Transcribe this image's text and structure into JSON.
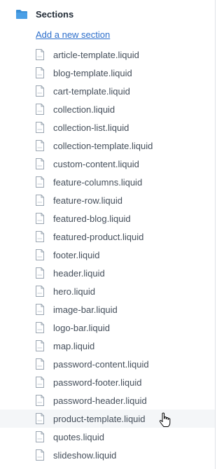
{
  "sidebar": {
    "section_title": "Sections",
    "add_link": "Add a new section",
    "files": [
      "article-template.liquid",
      "blog-template.liquid",
      "cart-template.liquid",
      "collection.liquid",
      "collection-list.liquid",
      "collection-template.liquid",
      "custom-content.liquid",
      "feature-columns.liquid",
      "feature-row.liquid",
      "featured-blog.liquid",
      "featured-product.liquid",
      "footer.liquid",
      "header.liquid",
      "hero.liquid",
      "image-bar.liquid",
      "logo-bar.liquid",
      "map.liquid",
      "password-content.liquid",
      "password-footer.liquid",
      "password-header.liquid",
      "product-template.liquid",
      "quotes.liquid",
      "slideshow.liquid"
    ],
    "hovered_file": "product-template.liquid"
  },
  "colors": {
    "folder": "#3a8fd6",
    "link": "#2c6ecb",
    "text": "#454f5b",
    "hover_bg": "#f4f6f8"
  },
  "icons": {
    "folder": "folder-icon",
    "file": "file-icon",
    "cursor": "hand-pointer-icon"
  }
}
